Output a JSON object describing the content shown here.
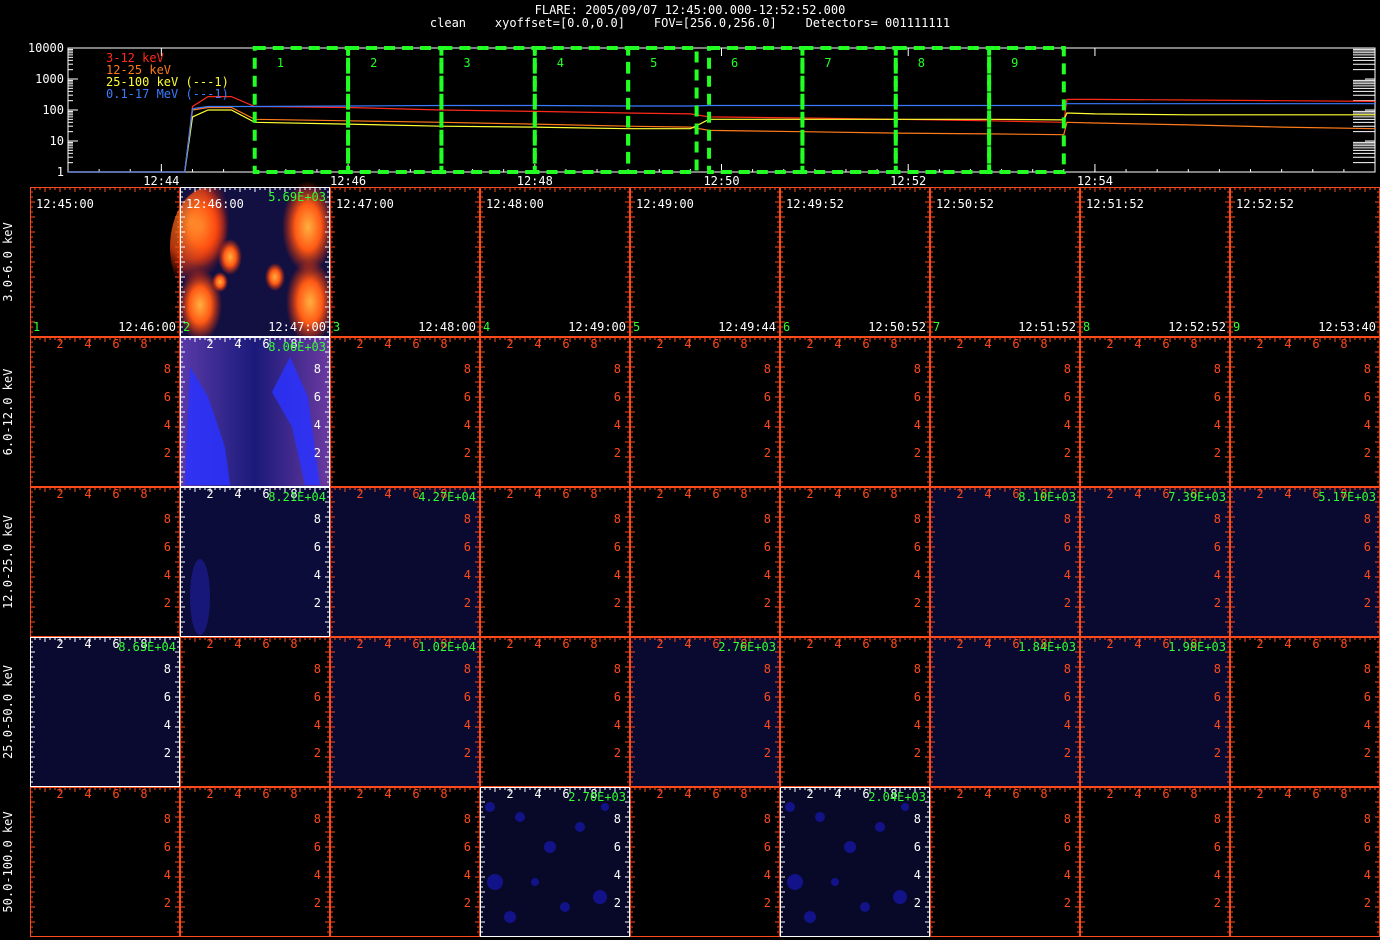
{
  "header": {
    "line1": "FLARE: 2005/09/07 12:45:00.000-12:52:52.000",
    "line2": "clean    xyoffset=[0.0,0.0]    FOV=[256.0,256.0]    Detectors= 001111111"
  },
  "colors": {
    "frame": "#ff4a1c",
    "white_frame": "#ffffff",
    "interval_box": "#22ff22",
    "label_green": "#33ff33"
  },
  "chart_data": [
    {
      "type": "line",
      "title": "",
      "xlabel": "",
      "ylabel": "",
      "x_ticks": [
        "12:44",
        "12:46",
        "12:48",
        "12:50",
        "12:52",
        "12:54"
      ],
      "y_ticks": [
        "1",
        "10",
        "100",
        "1000",
        "10000"
      ],
      "ylim": [
        1,
        10000
      ],
      "yscale": "log",
      "x": [
        "12:43:00",
        "12:44:15",
        "12:44:20",
        "12:44:30",
        "12:44:45",
        "12:45:00",
        "12:46:00",
        "12:47:00",
        "12:48:00",
        "12:49:00",
        "12:49:40",
        "12:49:52",
        "12:50:52",
        "12:51:52",
        "12:52:52",
        "12:53:40",
        "12:53:42",
        "12:54:00",
        "12:55:00",
        "12:56:00",
        "12:57:00"
      ],
      "series": [
        {
          "name": "3-12 keV",
          "color": "#ff2a1a",
          "values": [
            1,
            1,
            130,
            270,
            270,
            130,
            120,
            100,
            90,
            80,
            75,
            60,
            55,
            50,
            45,
            40,
            220,
            220,
            210,
            200,
            190
          ]
        },
        {
          "name": "12-25 keV",
          "color": "#ff7a1a",
          "values": [
            1,
            1,
            100,
            120,
            120,
            50,
            45,
            40,
            35,
            30,
            28,
            22,
            20,
            18,
            17,
            16,
            40,
            38,
            33,
            28,
            25
          ]
        },
        {
          "name": "25-100 keV (---1)",
          "color": "#ffff33",
          "values": [
            1,
            1,
            60,
            100,
            100,
            40,
            35,
            30,
            28,
            25,
            25,
            50,
            50,
            50,
            50,
            48,
            80,
            75,
            70,
            70,
            70
          ]
        },
        {
          "name": "0.1-17 MeV (---1)",
          "color": "#3a7aff",
          "values": [
            1,
            1,
            110,
            130,
            130,
            130,
            135,
            140,
            140,
            135,
            135,
            140,
            140,
            140,
            140,
            140,
            160,
            160,
            160,
            160,
            160
          ]
        }
      ],
      "intervals": [
        "1",
        "2",
        "3",
        "4",
        "5",
        "6",
        "7",
        "8",
        "9"
      ]
    },
    {
      "type": "heatmap",
      "title": "",
      "row_labels": [
        "3.0-6.0 keV",
        "6.0-12.0 keV",
        "12.0-25.0 keV",
        "25.0-50.0 keV",
        "50.0-100.0 keV"
      ],
      "columns": [
        {
          "num": "1",
          "start": "12:45:00",
          "end": "12:46:00"
        },
        {
          "num": "2",
          "start": "12:46:00",
          "end": "12:47:00"
        },
        {
          "num": "3",
          "start": "12:47:00",
          "end": "12:48:00"
        },
        {
          "num": "4",
          "start": "12:48:00",
          "end": "12:49:00"
        },
        {
          "num": "5",
          "start": "12:49:00",
          "end": "12:49:44"
        },
        {
          "num": "6",
          "start": "12:49:52",
          "end": "12:50:52"
        },
        {
          "num": "7",
          "start": "12:50:52",
          "end": "12:51:52"
        },
        {
          "num": "8",
          "start": "12:51:52",
          "end": "12:52:52"
        },
        {
          "num": "9",
          "start": "12:52:52",
          "end": "12:53:40"
        }
      ],
      "axis_ticks": [
        "2",
        "4",
        "6",
        "8"
      ],
      "cells": [
        {
          "row": 0,
          "col": 1,
          "max": "5.69E+03",
          "style": "hot"
        },
        {
          "row": 1,
          "col": 1,
          "max": "8.06E+03",
          "style": "blue"
        },
        {
          "row": 2,
          "col": 1,
          "max": "8.21E+04",
          "style": "dimblue"
        },
        {
          "row": 2,
          "col": 2,
          "max": "4.27E+04",
          "style": "dark"
        },
        {
          "row": 2,
          "col": 6,
          "max": "8.10E+03",
          "style": "dark"
        },
        {
          "row": 2,
          "col": 7,
          "max": "7.39E+03",
          "style": "dark"
        },
        {
          "row": 2,
          "col": 8,
          "max": "5.17E+03",
          "style": "dark"
        },
        {
          "row": 3,
          "col": 0,
          "max": "8.63E+04",
          "style": "dark"
        },
        {
          "row": 3,
          "col": 2,
          "max": "1.02E+04",
          "style": "dark"
        },
        {
          "row": 3,
          "col": 4,
          "max": "2.76E+03",
          "style": "dark"
        },
        {
          "row": 3,
          "col": 6,
          "max": "1.84E+03",
          "style": "dark"
        },
        {
          "row": 3,
          "col": 7,
          "max": "1.98E+03",
          "style": "dark"
        },
        {
          "row": 4,
          "col": 3,
          "max": "2.70E+03",
          "style": "noisy"
        },
        {
          "row": 4,
          "col": 5,
          "max": "2.04E+03",
          "style": "noisy"
        }
      ]
    }
  ]
}
